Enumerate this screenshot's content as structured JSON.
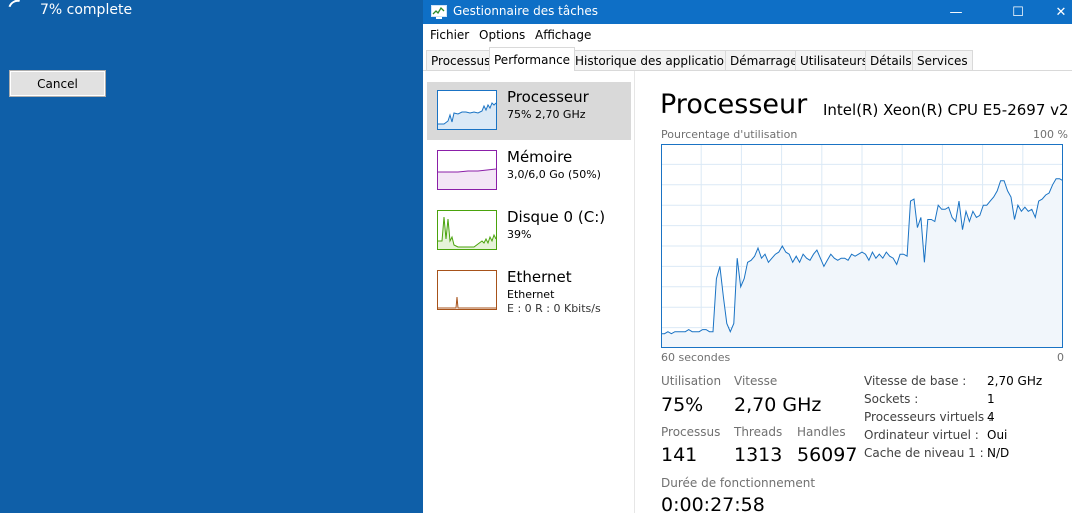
{
  "installer": {
    "progress_text": "7% complete",
    "cancel_label": "Cancel"
  },
  "window": {
    "title": "Gestionnaire des tâches",
    "controls": {
      "minimize": "—",
      "maximize": "☐",
      "close": "✕"
    }
  },
  "menu": [
    "Fichier",
    "Options",
    "Affichage"
  ],
  "tabs": [
    "Processus",
    "Performance",
    "Historique des applications",
    "Démarrage",
    "Utilisateurs",
    "Détails",
    "Services"
  ],
  "active_tab": "Performance",
  "sidebar": [
    {
      "title": "Processeur",
      "subtitle": "75% 2,70 GHz",
      "color": "#1a73c4",
      "selected": true
    },
    {
      "title": "Mémoire",
      "subtitle": "3,0/6,0 Go (50%)",
      "color": "#8b1fa8",
      "selected": false
    },
    {
      "title": "Disque 0 (C:)",
      "subtitle": "39%",
      "color": "#4aa30c",
      "selected": false
    },
    {
      "title": "Ethernet",
      "subtitle": "Ethernet",
      "subtitle2": "E : 0 R : 0 Kbits/s",
      "color": "#a7521a",
      "selected": false
    }
  ],
  "main": {
    "title": "Processeur",
    "cpu_model": "Intel(R) Xeon(R) CPU E5-2697 v2 ...",
    "util_label": "Pourcentage d'utilisation",
    "max_label": "100 %",
    "time_left": "60 secondes",
    "time_right": "0",
    "stats": {
      "utilisation_label": "Utilisation",
      "utilisation": "75%",
      "vitesse_label": "Vitesse",
      "vitesse": "2,70 GHz",
      "processus_label": "Processus",
      "processus": "141",
      "threads_label": "Threads",
      "threads": "1313",
      "handles_label": "Handles",
      "handles": "56097",
      "uptime_label": "Durée de fonctionnement",
      "uptime": "0:00:27:58"
    },
    "details": [
      {
        "key": "Vitesse de base :",
        "value": "2,70 GHz"
      },
      {
        "key": "Sockets :",
        "value": "1"
      },
      {
        "key": "Processeurs virtuels :",
        "value": "4"
      },
      {
        "key": "Ordinateur virtuel :",
        "value": "Oui"
      },
      {
        "key": "Cache de niveau 1 :",
        "value": "N/D"
      }
    ]
  },
  "chart_data": {
    "type": "area",
    "ylim": [
      0,
      100
    ],
    "x_label_left": "60 secondes",
    "x_label_right": "0",
    "values": [
      7,
      7,
      8,
      7,
      8,
      8,
      8,
      8,
      9,
      8,
      8,
      8,
      9,
      9,
      8,
      8,
      34,
      40,
      25,
      12,
      8,
      12,
      44,
      30,
      34,
      42,
      43,
      45,
      49,
      44,
      46,
      42,
      44,
      46,
      47,
      50,
      47,
      46,
      42,
      45,
      42,
      46,
      44,
      43,
      46,
      48,
      44,
      40,
      43,
      46,
      44,
      43,
      44,
      44,
      43,
      46,
      45,
      46,
      47,
      46,
      43,
      47,
      44,
      46,
      44,
      47,
      45,
      44,
      41,
      46,
      46,
      45,
      72,
      73,
      59,
      64,
      42,
      63,
      63,
      62,
      70,
      68,
      68,
      69,
      64,
      62,
      72,
      58,
      67,
      62,
      67,
      64,
      65,
      70,
      70,
      72,
      74,
      77,
      82,
      82,
      77,
      74,
      63,
      70,
      67,
      69,
      67,
      68,
      64,
      72,
      73,
      75,
      76,
      80,
      83,
      83,
      82
    ]
  }
}
